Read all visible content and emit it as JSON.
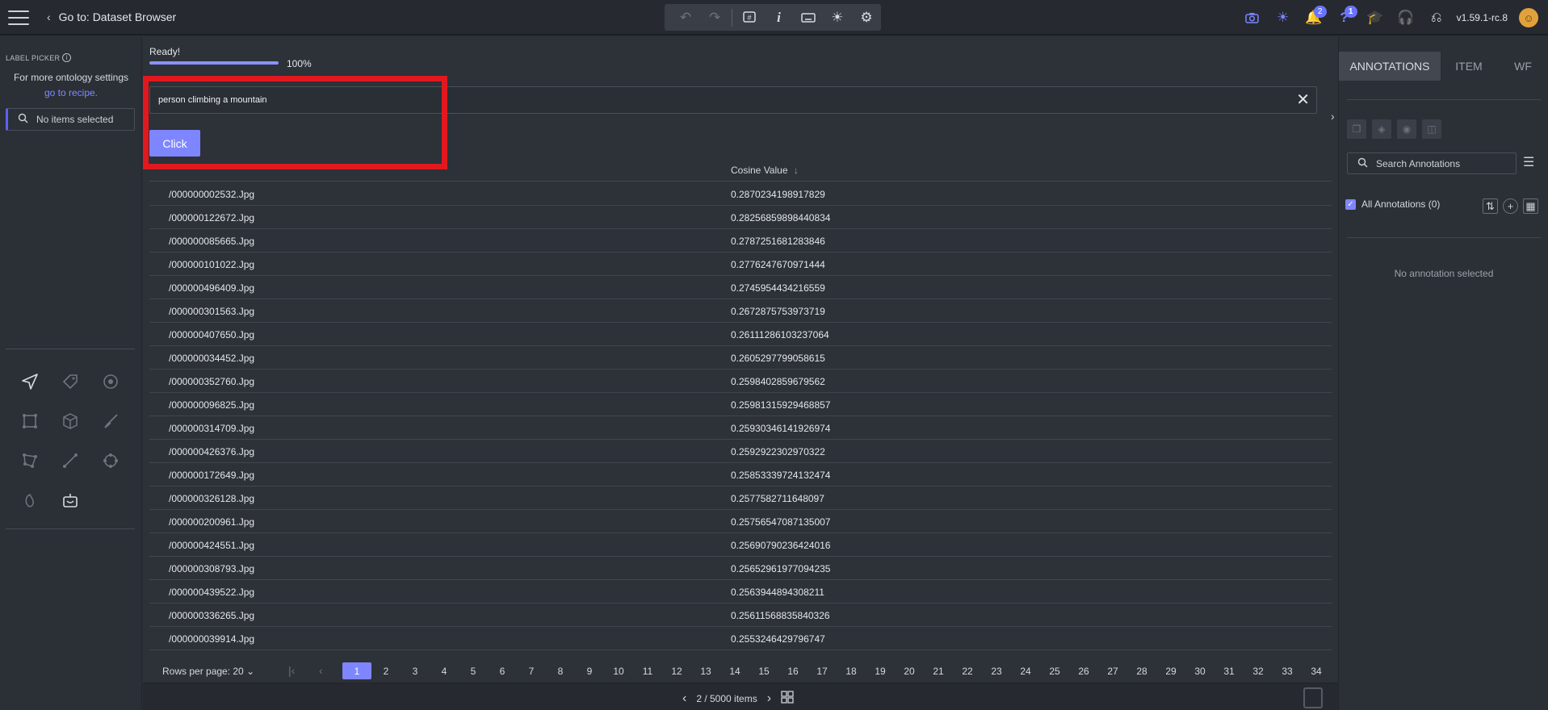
{
  "topbar": {
    "back_label": "Go to: Dataset Browser",
    "version": "v1.59.1-rc.8",
    "notifications_count": "2",
    "help_count": "1"
  },
  "left_panel": {
    "title": "LABEL PICKER",
    "ontology_text": "For more ontology settings",
    "recipe_link": "go to recipe.",
    "search_placeholder": "No items selected"
  },
  "main": {
    "status": "Ready!",
    "progress": 100,
    "progress_label": "100%",
    "query": "person climbing a mountain",
    "click_label": "Click",
    "column_header": "Cosine Value",
    "sort_icon": "↓",
    "rows": [
      {
        "file": "/000000002532.Jpg",
        "value": "0.2870234198917829"
      },
      {
        "file": "/000000122672.Jpg",
        "value": "0.28256859898440834"
      },
      {
        "file": "/000000085665.Jpg",
        "value": "0.2787251681283846"
      },
      {
        "file": "/000000101022.Jpg",
        "value": "0.2776247670971444"
      },
      {
        "file": "/000000496409.Jpg",
        "value": "0.2745954434216559"
      },
      {
        "file": "/000000301563.Jpg",
        "value": "0.2672875753973719"
      },
      {
        "file": "/000000407650.Jpg",
        "value": "0.26111286103237064"
      },
      {
        "file": "/000000034452.Jpg",
        "value": "0.2605297799058615"
      },
      {
        "file": "/000000352760.Jpg",
        "value": "0.2598402859679562"
      },
      {
        "file": "/000000096825.Jpg",
        "value": "0.25981315929468857"
      },
      {
        "file": "/000000314709.Jpg",
        "value": "0.25930346141926974"
      },
      {
        "file": "/000000426376.Jpg",
        "value": "0.2592922302970322"
      },
      {
        "file": "/000000172649.Jpg",
        "value": "0.25853339724132474"
      },
      {
        "file": "/000000326128.Jpg",
        "value": "0.2577582711648097"
      },
      {
        "file": "/000000200961.Jpg",
        "value": "0.25756547087135007"
      },
      {
        "file": "/000000424551.Jpg",
        "value": "0.25690790236424016"
      },
      {
        "file": "/000000308793.Jpg",
        "value": "0.25652961977094235"
      },
      {
        "file": "/000000439522.Jpg",
        "value": "0.2563944894308211"
      },
      {
        "file": "/000000336265.Jpg",
        "value": "0.25611568835840326"
      },
      {
        "file": "/000000039914.Jpg",
        "value": "0.2553246429796747"
      }
    ],
    "rows_per_page": "Rows per page: 20",
    "pages": [
      "1",
      "2",
      "3",
      "4",
      "5",
      "6",
      "7",
      "8",
      "9",
      "10",
      "11",
      "12",
      "13",
      "14",
      "15",
      "16",
      "17",
      "18",
      "19",
      "20",
      "21",
      "22",
      "23",
      "24",
      "25",
      "26",
      "27",
      "28",
      "29",
      "30",
      "31",
      "32",
      "33",
      "34"
    ],
    "active_page": "1",
    "item_counter": "2 / 5000 items"
  },
  "right_panel": {
    "tabs": [
      "ANNOTATIONS",
      "ITEM",
      "WF"
    ],
    "search_placeholder": "Search Annotations",
    "all_annotations": "All Annotations (0)",
    "empty_text": "No annotation selected"
  },
  "colors": {
    "accent": "#7e86ff",
    "highlight_box": "#e1181e",
    "background": "#2b2f36"
  }
}
